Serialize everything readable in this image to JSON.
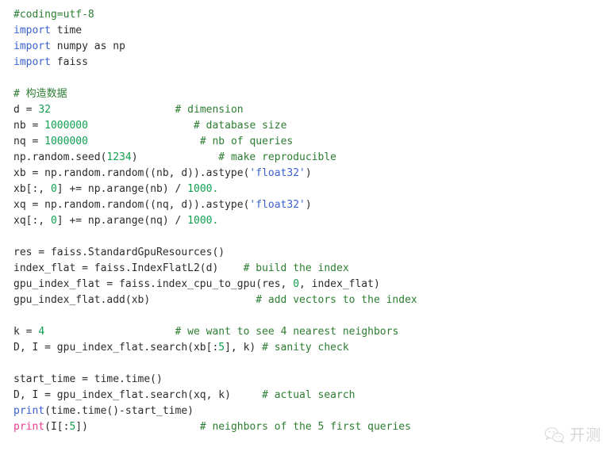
{
  "document": {
    "type": "code-snippet",
    "language": "python",
    "background_color": "#ffffff"
  },
  "theme": {
    "comment_color": "#2c7d32",
    "keyword_color": "#3a5fcd",
    "number_color": "#12a050",
    "string_color": "#3a5fcd",
    "plain_color": "#2b2b2b",
    "builtin_color": "#3a5fcd",
    "builtin_highlight_color": "#ea3c8f",
    "watermark_color": "#d5d5d5"
  },
  "code": {
    "lines": [
      {
        "index": 1,
        "text": "#coding=utf-8",
        "tokens": [
          {
            "t": "#coding=utf-8",
            "c": "tok-com"
          }
        ]
      },
      {
        "index": 2,
        "text": "import time",
        "tokens": [
          {
            "t": "import",
            "c": "tok-kw"
          },
          {
            "t": " time",
            "c": "tok-plain"
          }
        ]
      },
      {
        "index": 3,
        "text": "import numpy as np",
        "tokens": [
          {
            "t": "import",
            "c": "tok-kw"
          },
          {
            "t": " numpy ",
            "c": "tok-plain"
          },
          {
            "t": "as",
            "c": "tok-plain"
          },
          {
            "t": " np",
            "c": "tok-plain"
          }
        ]
      },
      {
        "index": 4,
        "text": "import faiss",
        "tokens": [
          {
            "t": "import",
            "c": "tok-kw"
          },
          {
            "t": " faiss",
            "c": "tok-plain"
          }
        ]
      },
      {
        "index": 5,
        "text": "",
        "tokens": []
      },
      {
        "index": 6,
        "text": "# 构造数据",
        "tokens": [
          {
            "t": "# 构造数据",
            "c": "tok-com"
          }
        ]
      },
      {
        "index": 7,
        "text": "d = 32                    # dimension",
        "tokens": [
          {
            "t": "d = ",
            "c": "tok-plain"
          },
          {
            "t": "32",
            "c": "tok-num"
          },
          {
            "t": "                    ",
            "c": "tok-plain"
          },
          {
            "t": "# dimension",
            "c": "tok-com"
          }
        ]
      },
      {
        "index": 8,
        "text": "nb = 1000000                 # database size",
        "tokens": [
          {
            "t": "nb = ",
            "c": "tok-plain"
          },
          {
            "t": "1000000",
            "c": "tok-num"
          },
          {
            "t": "                 ",
            "c": "tok-plain"
          },
          {
            "t": "# database size",
            "c": "tok-com"
          }
        ]
      },
      {
        "index": 9,
        "text": "nq = 1000000                  # nb of queries",
        "tokens": [
          {
            "t": "nq = ",
            "c": "tok-plain"
          },
          {
            "t": "1000000",
            "c": "tok-num"
          },
          {
            "t": "                  ",
            "c": "tok-plain"
          },
          {
            "t": "# nb of queries",
            "c": "tok-com"
          }
        ]
      },
      {
        "index": 10,
        "text": "np.random.seed(1234)             # make reproducible",
        "tokens": [
          {
            "t": "np.random.seed(",
            "c": "tok-plain"
          },
          {
            "t": "1234",
            "c": "tok-num"
          },
          {
            "t": ")",
            "c": "tok-plain"
          },
          {
            "t": "             ",
            "c": "tok-plain"
          },
          {
            "t": "# make reproducible",
            "c": "tok-com"
          }
        ]
      },
      {
        "index": 11,
        "text": "xb = np.random.random((nb, d)).astype('float32')",
        "tokens": [
          {
            "t": "xb = np.random.random((nb, d)).astype(",
            "c": "tok-plain"
          },
          {
            "t": "'float32'",
            "c": "tok-str"
          },
          {
            "t": ")",
            "c": "tok-plain"
          }
        ]
      },
      {
        "index": 12,
        "text": "xb[:, 0] += np.arange(nb) / 1000.",
        "tokens": [
          {
            "t": "xb[:, ",
            "c": "tok-plain"
          },
          {
            "t": "0",
            "c": "tok-num"
          },
          {
            "t": "] += np.arange(nb) / ",
            "c": "tok-plain"
          },
          {
            "t": "1000.",
            "c": "tok-num"
          }
        ]
      },
      {
        "index": 13,
        "text": "xq = np.random.random((nq, d)).astype('float32')",
        "tokens": [
          {
            "t": "xq = np.random.random((nq, d)).astype(",
            "c": "tok-plain"
          },
          {
            "t": "'float32'",
            "c": "tok-str"
          },
          {
            "t": ")",
            "c": "tok-plain"
          }
        ]
      },
      {
        "index": 14,
        "text": "xq[:, 0] += np.arange(nq) / 1000.",
        "tokens": [
          {
            "t": "xq[:, ",
            "c": "tok-plain"
          },
          {
            "t": "0",
            "c": "tok-num"
          },
          {
            "t": "] += np.arange(nq) / ",
            "c": "tok-plain"
          },
          {
            "t": "1000.",
            "c": "tok-num"
          }
        ]
      },
      {
        "index": 15,
        "text": "",
        "tokens": []
      },
      {
        "index": 16,
        "text": "res = faiss.StandardGpuResources()",
        "tokens": [
          {
            "t": "res = faiss.StandardGpuResources()",
            "c": "tok-plain"
          }
        ]
      },
      {
        "index": 17,
        "text": "index_flat = faiss.IndexFlatL2(d)    # build the index",
        "tokens": [
          {
            "t": "index_flat = faiss.IndexFlatL2(d)",
            "c": "tok-plain"
          },
          {
            "t": "    ",
            "c": "tok-plain"
          },
          {
            "t": "# build the index",
            "c": "tok-com"
          }
        ]
      },
      {
        "index": 18,
        "text": "gpu_index_flat = faiss.index_cpu_to_gpu(res, 0, index_flat)",
        "tokens": [
          {
            "t": "gpu_index_flat = faiss.index_cpu_to_gpu(res, ",
            "c": "tok-plain"
          },
          {
            "t": "0",
            "c": "tok-num"
          },
          {
            "t": ", index_flat)",
            "c": "tok-plain"
          }
        ]
      },
      {
        "index": 19,
        "text": "gpu_index_flat.add(xb)                 # add vectors to the index",
        "tokens": [
          {
            "t": "gpu_index_flat.add(xb)",
            "c": "tok-plain"
          },
          {
            "t": "                 ",
            "c": "tok-plain"
          },
          {
            "t": "# add vectors to the index",
            "c": "tok-com"
          }
        ]
      },
      {
        "index": 20,
        "text": "",
        "tokens": []
      },
      {
        "index": 21,
        "text": "k = 4                     # we want to see 4 nearest neighbors",
        "tokens": [
          {
            "t": "k = ",
            "c": "tok-plain"
          },
          {
            "t": "4",
            "c": "tok-num"
          },
          {
            "t": "                     ",
            "c": "tok-plain"
          },
          {
            "t": "# we want to see 4 nearest neighbors",
            "c": "tok-com"
          }
        ]
      },
      {
        "index": 22,
        "text": "D, I = gpu_index_flat.search(xb[:5], k) # sanity check",
        "tokens": [
          {
            "t": "D, I = gpu_index_flat.search(xb[:",
            "c": "tok-plain"
          },
          {
            "t": "5",
            "c": "tok-num"
          },
          {
            "t": "], k) ",
            "c": "tok-plain"
          },
          {
            "t": "# sanity check",
            "c": "tok-com"
          }
        ]
      },
      {
        "index": 23,
        "text": "",
        "tokens": []
      },
      {
        "index": 24,
        "text": "start_time = time.time()",
        "tokens": [
          {
            "t": "start_time = time.time()",
            "c": "tok-plain"
          }
        ]
      },
      {
        "index": 25,
        "text": "D, I = gpu_index_flat.search(xq, k)     # actual search",
        "tokens": [
          {
            "t": "D, I = gpu_index_flat.search(xq, k)",
            "c": "tok-plain"
          },
          {
            "t": "     ",
            "c": "tok-plain"
          },
          {
            "t": "# actual search",
            "c": "tok-com"
          }
        ]
      },
      {
        "index": 26,
        "text": "print(time.time()-start_time)",
        "tokens": [
          {
            "t": "print",
            "c": "tok-fn"
          },
          {
            "t": "(time.time()-start_time)",
            "c": "tok-plain"
          }
        ]
      },
      {
        "index": 27,
        "text": "print(I[:5])                  # neighbors of the 5 first queries",
        "tokens": [
          {
            "t": "print",
            "c": "tok-fn-hl"
          },
          {
            "t": "(I[:",
            "c": "tok-plain"
          },
          {
            "t": "5",
            "c": "tok-num"
          },
          {
            "t": "])",
            "c": "tok-plain"
          },
          {
            "t": "                  ",
            "c": "tok-plain"
          },
          {
            "t": "# neighbors of the 5 first queries",
            "c": "tok-com"
          }
        ]
      }
    ]
  },
  "watermark": {
    "icon": "wechat-icon",
    "text": "开测"
  }
}
